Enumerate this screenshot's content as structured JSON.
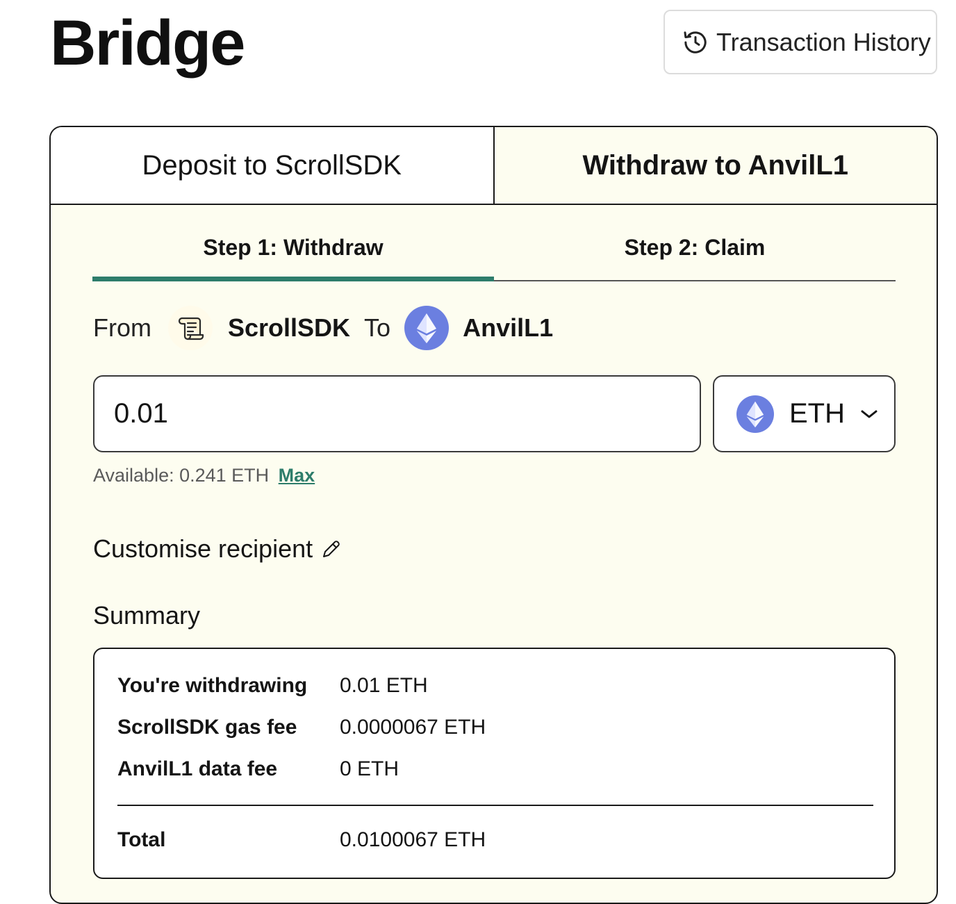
{
  "header": {
    "title": "Bridge",
    "history_button_label": "Transaction History"
  },
  "tabs": {
    "deposit_label": "Deposit to ScrollSDK",
    "withdraw_label": "Withdraw to AnvilL1",
    "active": "withdraw"
  },
  "steps": {
    "step1_label": "Step 1: Withdraw",
    "step2_label": "Step 2: Claim",
    "active": "step1"
  },
  "route": {
    "from_label": "From",
    "from_chain": "ScrollSDK",
    "to_label": "To",
    "to_chain": "AnvilL1"
  },
  "amount": {
    "value": "0.01"
  },
  "token": {
    "symbol": "ETH",
    "icon": "ethereum-icon"
  },
  "balance": {
    "text": "Available: 0.241 ETH",
    "max_label": "Max"
  },
  "recipient": {
    "label": "Customise recipient"
  },
  "summary": {
    "heading": "Summary",
    "rows": [
      {
        "label": "You're withdrawing",
        "value": "0.01 ETH"
      },
      {
        "label": "ScrollSDK gas fee",
        "value": "0.0000067 ETH"
      },
      {
        "label": "AnvilL1 data fee",
        "value": "0 ETH"
      }
    ],
    "total_label": "Total",
    "total_value": "0.0100067 ETH"
  },
  "colors": {
    "accent": "#2e7d6b",
    "card_background": "#fdfdf0",
    "ethereum": "#6b7fe0"
  }
}
